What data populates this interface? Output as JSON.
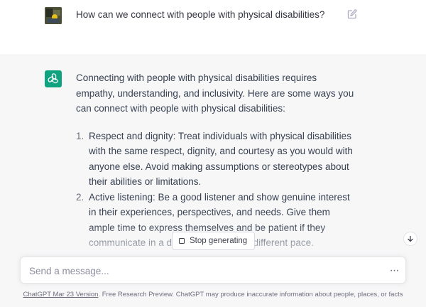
{
  "user_message": {
    "text": "How can we connect with people with physical disabilities?"
  },
  "assistant_message": {
    "intro": "Connecting with people with physical disabilities requires empathy, understanding, and inclusivity. Here are some ways you can connect with people with physical disabilities:",
    "items": [
      {
        "number": "1.",
        "text": "Respect and dignity: Treat individuals with physical disabilities with the same respect, dignity, and courtesy as you would with anyone else. Avoid making assumptions or stereotypes about their abilities or limitations."
      },
      {
        "number": "2.",
        "text": "Active listening: Be a good listener and show genuine interest in their experiences, perspectives, and needs. Give them ample time to express themselves and be patient if they communicate in a different way or at a different pace."
      }
    ]
  },
  "controls": {
    "stop_label": "Stop generating",
    "input_placeholder": "Send a message...",
    "more_label": "···"
  },
  "footer": {
    "version_link": "ChatGPT Mar 23 Version",
    "disclaimer": ". Free Research Preview. ChatGPT may produce inaccurate information about people, places, or facts"
  },
  "icons": {
    "edit": "edit-icon",
    "assistant_logo": "openai-logo-icon",
    "stop": "stop-square-icon",
    "scroll": "arrow-down-icon",
    "more": "more-dots-icon"
  },
  "colors": {
    "accent": "#10a37f",
    "assistant_bg": "#f7f7f8",
    "text": "#343541"
  }
}
